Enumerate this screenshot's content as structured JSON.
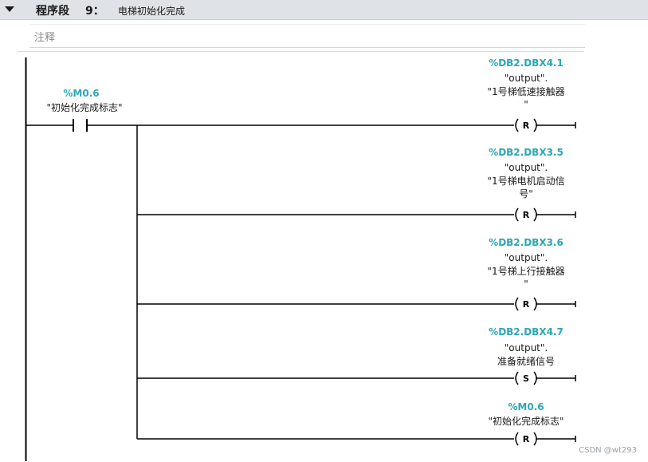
{
  "segment": {
    "title": "程序段",
    "number": "9：",
    "name": "电梯初始化完成",
    "comment_placeholder": "注释"
  },
  "contact": {
    "address": "%M0.6",
    "name": "\"初始化完成标志\""
  },
  "coils": [
    {
      "address": "%DB2.DBX4.1",
      "line1": "\"output\".",
      "line2": "\"1号梯低速接触器",
      "line3": "\"",
      "type": "R"
    },
    {
      "address": "%DB2.DBX3.5",
      "line1": "\"output\".",
      "line2": "\"1号梯电机启动信",
      "line3": "号\"",
      "type": "R"
    },
    {
      "address": "%DB2.DBX3.6",
      "line1": "\"output\".",
      "line2": "\"1号梯上行接触器",
      "line3": "\"",
      "type": "R"
    },
    {
      "address": "%DB2.DBX4.7",
      "line1": "\"output\".",
      "line2": "准备就绪信号",
      "line3": "",
      "type": "S"
    },
    {
      "address": "%M0.6",
      "line1": "\"初始化完成标志\"",
      "line2": "",
      "line3": "",
      "type": "R"
    }
  ],
  "watermark": "CSDN @wt293"
}
